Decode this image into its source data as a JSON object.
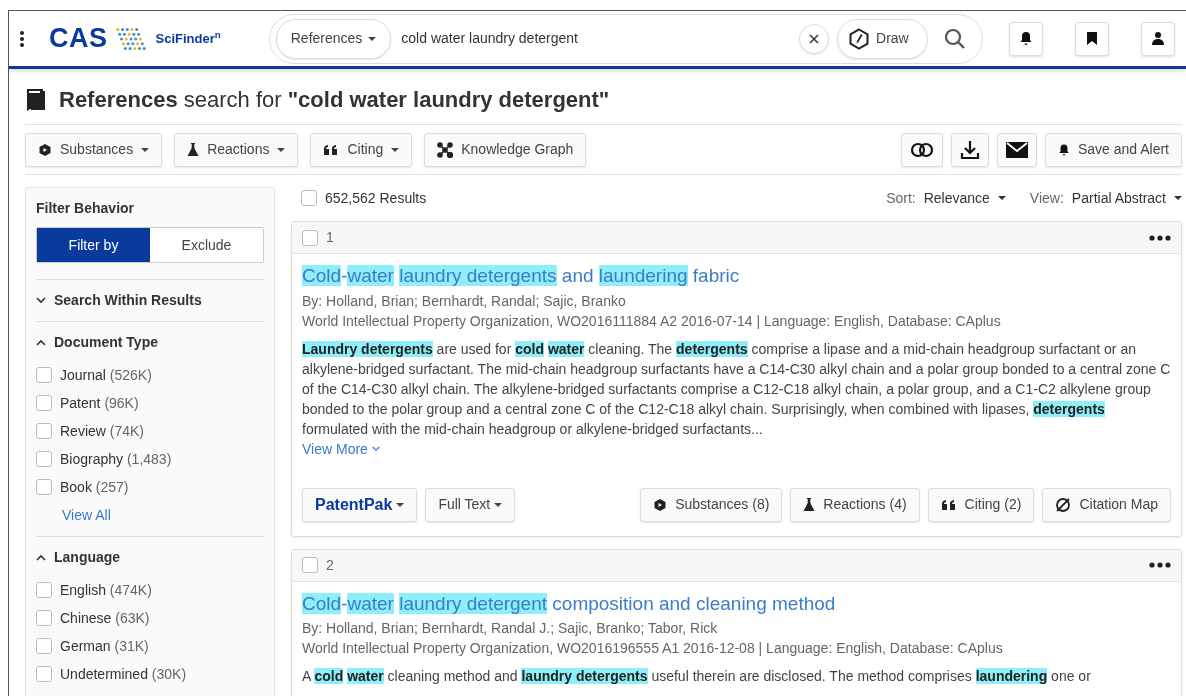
{
  "header": {
    "brand": "CAS",
    "product": "SciFinder$^{n}$"
  },
  "search": {
    "type": "References",
    "query": "cold water laundry detergent",
    "draw": "Draw"
  },
  "page_title": "**References** search for **\"cold water laundry detergent\"**",
  "toolbar": {
    "buttons": [
      {
        "label": "Substances",
        "kind": "substance",
        "dropdown": true
      },
      {
        "label": "Reactions",
        "kind": "reaction",
        "dropdown": true
      },
      {
        "label": "Citing",
        "kind": "citing",
        "dropdown": true
      },
      {
        "label": "Knowledge Graph",
        "kind": "graph",
        "dropdown": false
      }
    ],
    "save_alert": "Save and Alert"
  },
  "filters": {
    "title": "Filter Behavior",
    "modes": [
      {
        "label": "Filter by",
        "selected": true
      },
      {
        "label": "Exclude",
        "selected": false
      }
    ],
    "sections": [
      {
        "title": "Search Within Results",
        "expanded": false
      },
      {
        "title": "Document Type",
        "expanded": true,
        "view_all": "View All",
        "options": [
          {
            "label": "Journal",
            "count": "(526K)",
            "checked": false
          },
          {
            "label": "Patent",
            "count": "(96K)",
            "checked": false
          },
          {
            "label": "Review",
            "count": "(74K)",
            "checked": false
          },
          {
            "label": "Biography",
            "count": "(1,483)",
            "checked": false
          },
          {
            "label": "Book",
            "count": "(257)",
            "checked": false
          }
        ]
      },
      {
        "title": "Language",
        "expanded": true,
        "options": [
          {
            "label": "English",
            "count": "(474K)",
            "checked": false
          },
          {
            "label": "Chinese",
            "count": "(63K)",
            "checked": false
          },
          {
            "label": "German",
            "count": "(31K)",
            "checked": false
          },
          {
            "label": "Undetermined",
            "count": "(30K)",
            "checked": false
          }
        ]
      }
    ]
  },
  "results": {
    "all_checked": false,
    "count": "652,562 Results",
    "sort_label": "Sort:",
    "sort": "Relevance",
    "view_label": "View:",
    "view": "Partial Abstract",
    "items": [
      {
        "number": "1",
        "checked": false,
        "title": "**Cold**-**water** **laundry detergents** and **laundering** fabric",
        "authors": "By: Holland, Brian; Bernhardt, Randal; Sajic, Branko",
        "source": "World Intellectual Property Organization, WO2016111884 A2 2016-07-14 | Language: English, Database: CAplus",
        "abstract": "**Laundry detergents** are used for **cold** **water** cleaning. The **detergents** comprise a lipase and a mid-chain headgroup surfactant or an alkylene-bridged surfactant. The mid-chain headgroup surfactants have a C14-C30 alkyl chain and a polar group bonded to a central zone C of the C14-C30 alkyl chain. The alkylene-bridged surfactants comprise a C12-C18 alkyl chain, a polar group, and a C1-C2 alkylene group bonded to the polar group and a central zone C of the C12-C18 alkyl chain. Surprisingly, when combined with lipases, **detergents** formulated with the mid-chain headgroup or alkylene-bridged surfactants...",
        "view_more": "View More",
        "actions_left": [
          {
            "label": "PatentPak",
            "kind": "patentpak",
            "dropdown": true
          },
          {
            "label": "Full Text",
            "kind": "plain",
            "dropdown": true
          }
        ],
        "actions_right": [
          {
            "label": "Substances (8)",
            "kind": "substance"
          },
          {
            "label": "Reactions (4)",
            "kind": "reaction"
          },
          {
            "label": "Citing (2)",
            "kind": "citing"
          },
          {
            "label": "Citation Map",
            "kind": "citation-map"
          }
        ]
      },
      {
        "number": "2",
        "checked": false,
        "title": "**Cold**-**water** **laundry detergent** composition and cleaning method",
        "authors": "By: Holland, Brian; Bernhardt, Randal J.; Sajic, Branko; Tabor, Rick",
        "source": "World Intellectual Property Organization, WO2016196555 A1 2016-12-08 | Language: English, Database: CAplus",
        "abstract": "A **cold** **water** cleaning method and **laundry detergents** useful therein are disclosed. The method comprises **laundering** one or"
      }
    ]
  }
}
